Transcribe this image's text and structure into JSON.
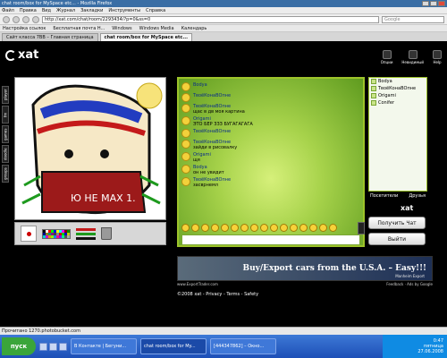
{
  "browser": {
    "title": "chat room/box for MySpace etc... - Mozilla Firefox",
    "menu": [
      "Файл",
      "Правка",
      "Вид",
      "Журнал",
      "Закладки",
      "Инструменты",
      "Справка"
    ],
    "url": "http://xat.com/chat/room/2293434/?p=0&ss=0",
    "search_placeholder": "Google",
    "bookmarks": [
      "Настройка ссылок",
      "Бесплатная почта H...",
      "Windows",
      "Windows Media",
      "Календарь"
    ],
    "tabs": [
      {
        "label": "Сайт класса 7ВВ – Главная страница"
      },
      {
        "label": "chat room/box for MySpace etc..."
      }
    ]
  },
  "xat": {
    "logo_text": "xat",
    "top_icons": [
      {
        "label": "Опции",
        "icon": "options-icon"
      },
      {
        "label": "Невидимый",
        "icon": "invisible-icon"
      },
      {
        "label": "Help",
        "icon": "help-icon"
      }
    ],
    "sidebar": [
      "player",
      "fm",
      "games",
      "doodle",
      "groups"
    ],
    "drawing_text": "Ю НЕ МАХ 1.",
    "chat": {
      "messages": [
        {
          "name": "Bodya",
          "text": ""
        },
        {
          "name": "ТвоёКонаВОпне",
          "text": ""
        },
        {
          "name": "ТвоёКонаВОпне",
          "text": "щас в дв моя картина"
        },
        {
          "name": "Origami",
          "text": "ЭТО БЕР ЗЗЗ БУГАГАГАГА"
        },
        {
          "name": "ТвоёКонаВОпне",
          "text": ""
        },
        {
          "name": "ТвоёКонаВОпне",
          "text": "зайди в рисовалку"
        },
        {
          "name": "Origami",
          "text": "щя"
        },
        {
          "name": "Bodya",
          "text": "он не увидит"
        },
        {
          "name": "ТвоёКонаВОпне",
          "text": "засврнемл"
        }
      ]
    },
    "users": {
      "list": [
        "Bodya",
        "ТвоёКонаВОпне",
        "Origami",
        "Conifer"
      ],
      "tab_visitors": "Посетители",
      "tab_friends": "Друзья"
    },
    "buttons": {
      "get_chat": "Получить Чат",
      "exit": "Выйти"
    },
    "ad": {
      "headline": "Buy/Export cars from the U.S.A. – Easy!!!",
      "brand": "Manheim Export",
      "left_label": "www.ExportTrader.com",
      "right_label": "Feedback · Ads by Google"
    },
    "footer": "©2008 xat - Privacy - Terms - Safety"
  },
  "status_bar": "Прочитано 1270.photobucket.com",
  "taskbar": {
    "start": "пуск",
    "tasks": [
      "В Контакте | Бегуни...",
      "chat room/box for My...",
      "[444347862] – Окно..."
    ],
    "time": "0:47",
    "day": "пятница",
    "date": "27.06.2008"
  },
  "colors": {
    "chat_accent": "#9dc32a",
    "name_color": "#0a2d8a"
  }
}
